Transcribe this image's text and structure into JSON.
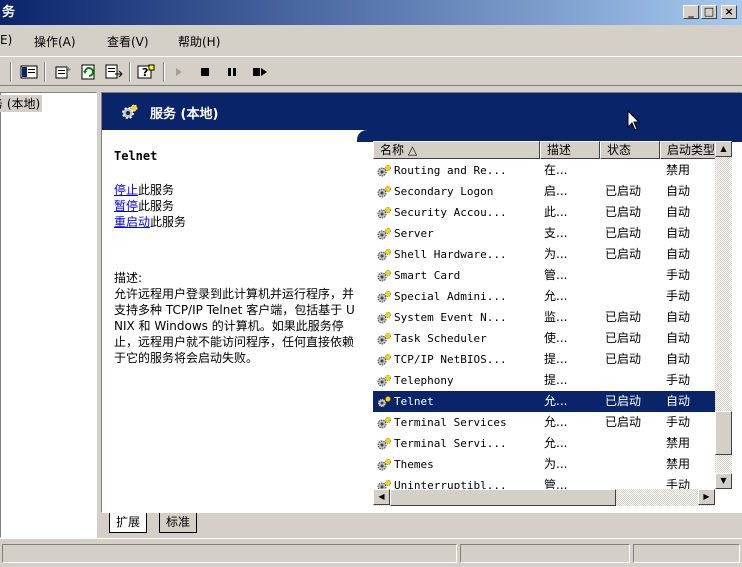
{
  "window": {
    "title": "务"
  },
  "menu": [
    {
      "label": "E)"
    },
    {
      "label": "操作(A)"
    },
    {
      "label": "查看(V)"
    },
    {
      "label": "帮助(H)"
    }
  ],
  "tree": {
    "selected_item": "务 (本地)"
  },
  "header": {
    "title": "服务 (本地)"
  },
  "detail": {
    "service_name": "Telnet",
    "stop_link": "停止",
    "stop_suffix": "此服务",
    "pause_link": "暂停",
    "pause_suffix": "此服务",
    "restart_link": "重启动",
    "restart_suffix": "此服务",
    "description_label": "描述:",
    "description_text": "允许远程用户登录到此计算机并运行程序，并支持多种 TCP/IP Telnet 客户端，包括基于 UNIX 和 Windows 的计算机。如果此服务停止，远程用户就不能访问程序，任何直接依赖于它的服务将会启动失败。"
  },
  "columns": {
    "name": "名称 △",
    "desc": "描述",
    "status": "状态",
    "startup": "启动类型"
  },
  "services": [
    {
      "name": "Routing and Re...",
      "desc": "在...",
      "status": "",
      "startup": "禁用"
    },
    {
      "name": "Secondary Logon",
      "desc": "启...",
      "status": "已启动",
      "startup": "自动"
    },
    {
      "name": "Security Accou...",
      "desc": "此...",
      "status": "已启动",
      "startup": "自动"
    },
    {
      "name": "Server",
      "desc": "支...",
      "status": "已启动",
      "startup": "自动"
    },
    {
      "name": "Shell Hardware...",
      "desc": "为...",
      "status": "已启动",
      "startup": "自动"
    },
    {
      "name": "Smart Card",
      "desc": "管...",
      "status": "",
      "startup": "手动"
    },
    {
      "name": "Special Admini...",
      "desc": "允...",
      "status": "",
      "startup": "手动"
    },
    {
      "name": "System Event N...",
      "desc": "监...",
      "status": "已启动",
      "startup": "自动"
    },
    {
      "name": "Task Scheduler",
      "desc": "使...",
      "status": "已启动",
      "startup": "自动"
    },
    {
      "name": "TCP/IP NetBIOS...",
      "desc": "提...",
      "status": "已启动",
      "startup": "自动"
    },
    {
      "name": "Telephony",
      "desc": "提...",
      "status": "",
      "startup": "手动"
    },
    {
      "name": "Telnet",
      "desc": "允...",
      "status": "已启动",
      "startup": "自动"
    },
    {
      "name": "Terminal Services",
      "desc": "允...",
      "status": "已启动",
      "startup": "手动"
    },
    {
      "name": "Terminal Servi...",
      "desc": "允...",
      "status": "",
      "startup": "禁用"
    },
    {
      "name": "Themes",
      "desc": "为...",
      "status": "",
      "startup": "禁用"
    },
    {
      "name": "Uninterruptibl...",
      "desc": "管...",
      "status": "",
      "startup": "手动"
    }
  ],
  "selected_index": 11,
  "tabs": {
    "extended": "扩展",
    "standard": "标准"
  },
  "colors": {
    "title_start": "#0a246a",
    "title_end": "#a6caf0",
    "selection": "#0a246a",
    "link": "#0000ff"
  }
}
